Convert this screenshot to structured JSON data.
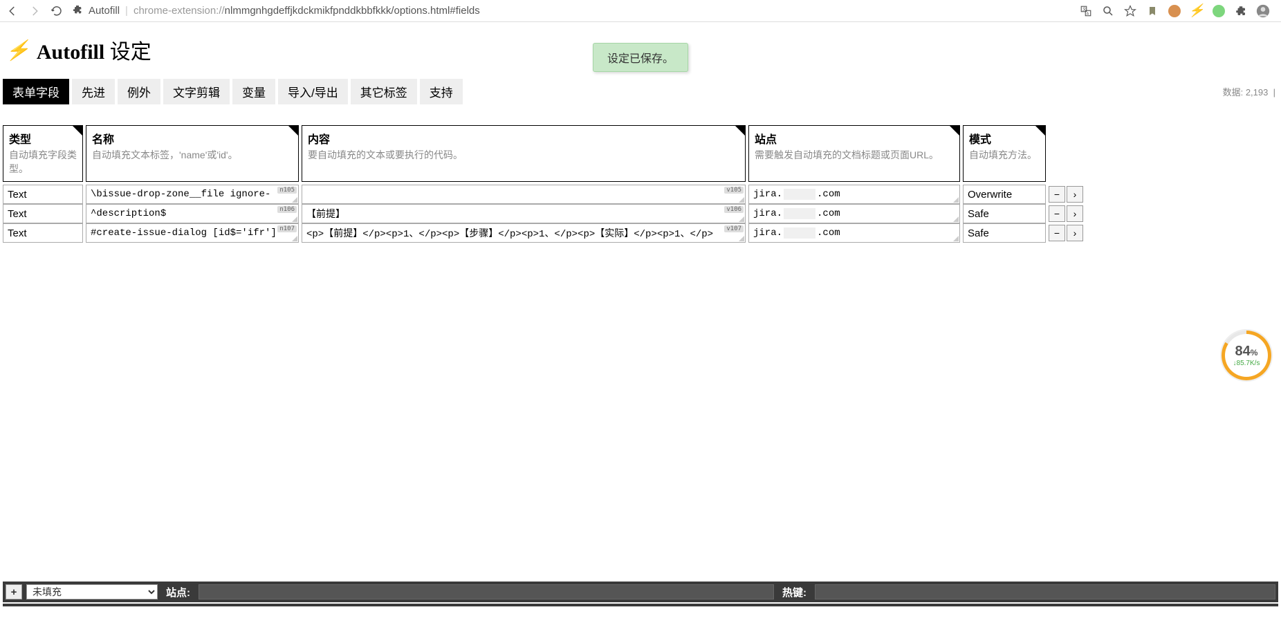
{
  "browser": {
    "page_name": "Autofill",
    "url_prefix": "chrome-extension://",
    "url_path": "nlmmgnhgdeffjkdckmikfpnddkbbfkkk/options.html#fields"
  },
  "header": {
    "title_bold": "Autofill",
    "title_rest": " 设定",
    "toast": "设定已保存。"
  },
  "tabs": {
    "items": [
      "表单字段",
      "先进",
      "例外",
      "文字剪辑",
      "变量",
      "导入/导出",
      "其它标签",
      "支持"
    ],
    "active_index": 0,
    "stats_label": "数据:",
    "stats_value": "2,193",
    "stats_sep": "|"
  },
  "columns": {
    "type": {
      "title": "类型",
      "sub": "自动填充字段类型。"
    },
    "name": {
      "title": "名称",
      "sub": "自动填充文本标签，'name'或'id'。"
    },
    "value": {
      "title": "内容",
      "sub": "要自动填充的文本或要执行的代码。"
    },
    "site": {
      "title": "站点",
      "sub": "需要触发自动填充的文档标题或页面URL。"
    },
    "mode": {
      "title": "模式",
      "sub": "自动填充方法。"
    }
  },
  "rows": [
    {
      "type": "Text",
      "name": "\\bissue-drop-zone__file ignore-",
      "name_badge": "n105",
      "value": "",
      "value_badge": "v105",
      "site_pre": "jira.",
      "site_post": ".com",
      "mode": "Overwrite"
    },
    {
      "type": "Text",
      "name": "^description$",
      "name_badge": "n106",
      "value": "【前提】",
      "value_badge": "v106",
      "site_pre": "jira.",
      "site_post": ".com",
      "mode": "Safe"
    },
    {
      "type": "Text",
      "name": "#create-issue-dialog  [id$='ifr']",
      "name_badge": "n107",
      "value": "<p>【前提】</p><p>1、</p><p>【步骤】</p><p>1、</p><p>【实际】</p><p>1、</p>",
      "value_badge": "v107",
      "site_pre": "jira.",
      "site_post": ".com",
      "mode": "Safe"
    }
  ],
  "bottom": {
    "add": "+",
    "select_value": "未填充",
    "site_label": "站点:",
    "hotkey_label": "热键:"
  },
  "speed": {
    "percent": "84",
    "percent_unit": "%",
    "rate": "↓85.7K/s"
  },
  "actions": {
    "minus": "−",
    "arrow": "›"
  }
}
